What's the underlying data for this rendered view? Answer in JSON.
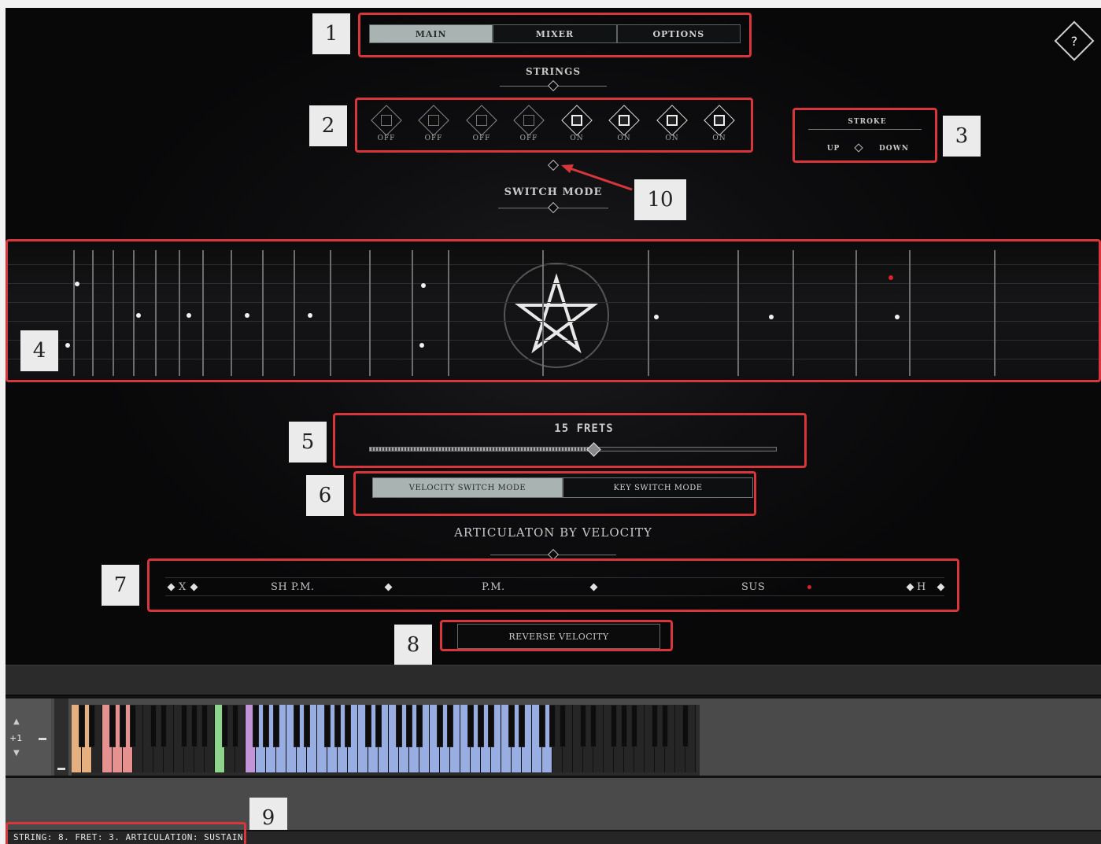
{
  "tabs": [
    {
      "label": "MAIN",
      "active": true
    },
    {
      "label": "MIXER",
      "active": false
    },
    {
      "label": "OPTIONS",
      "active": false
    }
  ],
  "strings_title": "STRINGS",
  "strings": [
    "OFF",
    "OFF",
    "OFF",
    "OFF",
    "ON",
    "ON",
    "ON",
    "ON"
  ],
  "stroke": {
    "title": "STROKE",
    "up": "UP",
    "down": "DOWN"
  },
  "switch_mode_title": "SWITCH MODE",
  "frets": {
    "label": "15 FRETS",
    "value": 15,
    "level": 0.55
  },
  "modes": [
    {
      "label": "VELOCITY SWITCH MODE",
      "active": true
    },
    {
      "label": "KEY SWITCH MODE",
      "active": false
    }
  ],
  "articulation_title": "ARTICULATON BY VELOCITY",
  "articulations": [
    "X",
    "SH P.M.",
    "P.M.",
    "SUS",
    "H"
  ],
  "reverse_velocity": "REVERSE VELOCITY",
  "keyboard": {
    "octave": "+1"
  },
  "status": "STRING: 8. FRET: 3. ARTICULATION: SUSTAIN",
  "callouts": [
    "1",
    "2",
    "3",
    "4",
    "5",
    "6",
    "7",
    "8",
    "9",
    "10"
  ],
  "help": "?"
}
